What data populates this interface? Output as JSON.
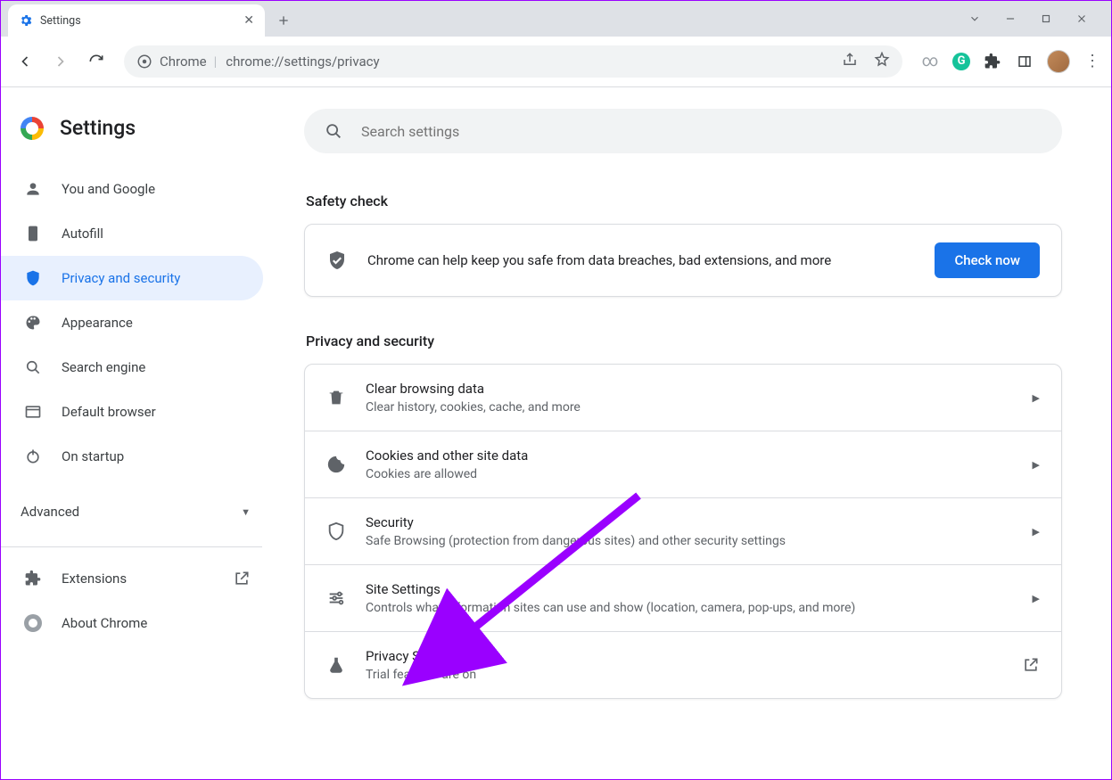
{
  "browser": {
    "tab_title": "Settings",
    "omnibox_label": "Chrome",
    "omnibox_url": "chrome://settings/privacy"
  },
  "page_header": {
    "title": "Settings",
    "search_placeholder": "Search settings"
  },
  "sidebar": {
    "items": [
      {
        "label": "You and Google"
      },
      {
        "label": "Autofill"
      },
      {
        "label": "Privacy and security"
      },
      {
        "label": "Appearance"
      },
      {
        "label": "Search engine"
      },
      {
        "label": "Default browser"
      },
      {
        "label": "On startup"
      }
    ],
    "advanced_label": "Advanced",
    "extensions_label": "Extensions",
    "about_label": "About Chrome"
  },
  "safety": {
    "heading": "Safety check",
    "text": "Chrome can help keep you safe from data breaches, bad extensions, and more",
    "button": "Check now"
  },
  "privacy": {
    "heading": "Privacy and security",
    "rows": [
      {
        "title": "Clear browsing data",
        "subtitle": "Clear history, cookies, cache, and more"
      },
      {
        "title": "Cookies and other site data",
        "subtitle": "Cookies are allowed"
      },
      {
        "title": "Security",
        "subtitle": "Safe Browsing (protection from dangerous sites) and other security settings"
      },
      {
        "title": "Site Settings",
        "subtitle": "Controls what information sites can use and show (location, camera, pop-ups, and more)"
      },
      {
        "title": "Privacy Sandbox",
        "subtitle": "Trial features are on"
      }
    ]
  }
}
